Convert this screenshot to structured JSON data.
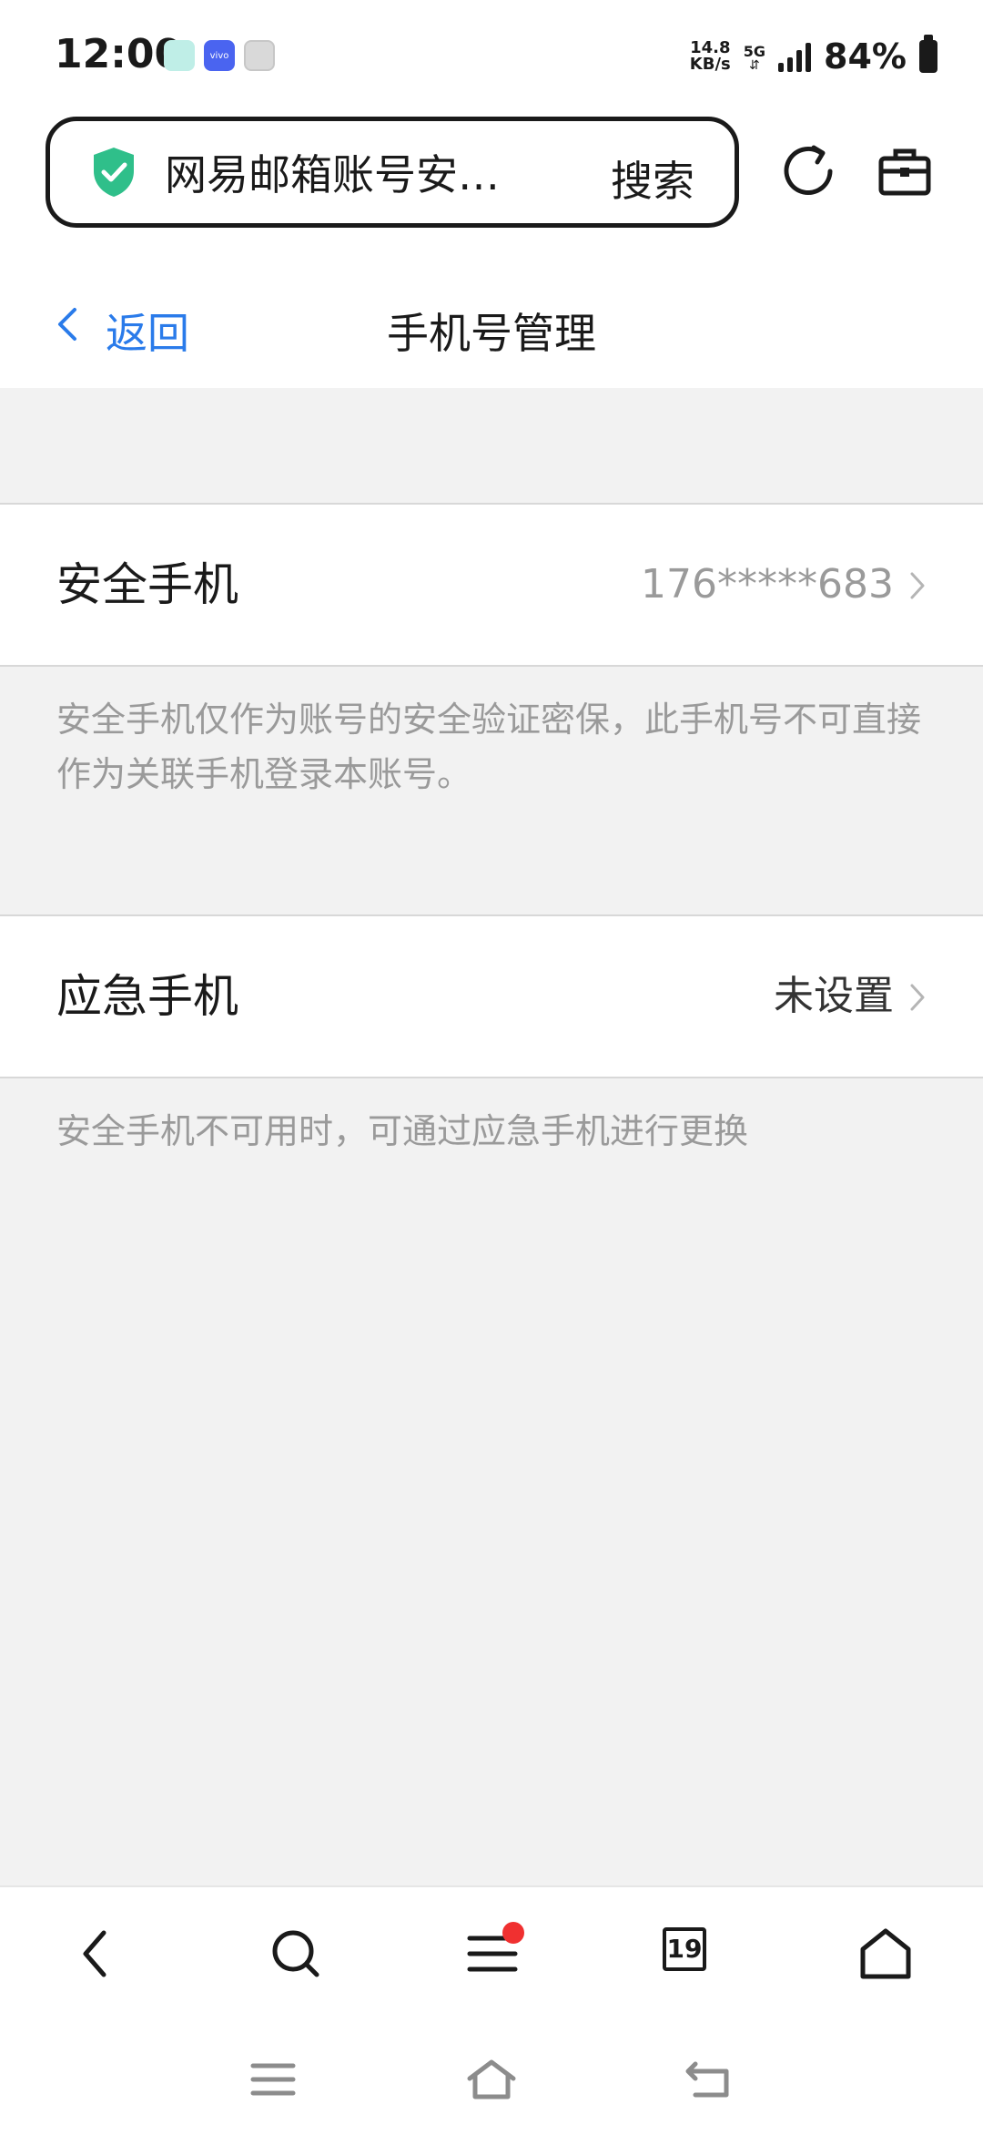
{
  "status_bar": {
    "time": "12:00",
    "net_speed_value": "14.8",
    "net_speed_unit": "KB/s",
    "network_type": "5G",
    "battery": "84%",
    "app_icons": [
      "teal-app-icon",
      "vivo-app-icon",
      "gray-app-icon"
    ],
    "vivo_label": "vivo"
  },
  "browser": {
    "url_text": "网易邮箱账号安…",
    "search_label": "搜索",
    "shield_color": "#2fbf8a"
  },
  "header": {
    "back_label": "返回",
    "title": "手机号管理"
  },
  "sections": {
    "security_phone": {
      "label": "安全手机",
      "value": "176*****683",
      "hint": "安全手机仅作为账号的安全验证密保，此手机号不可直接作为关联手机登录本账号。"
    },
    "emergency_phone": {
      "label": "应急手机",
      "value": "未设置",
      "hint": "安全手机不可用时，可通过应急手机进行更换"
    }
  },
  "bottom_nav": {
    "tab_count": "19",
    "items": [
      "back-icon",
      "search-icon",
      "menu-icon",
      "tabs-icon",
      "home-icon"
    ],
    "badge_color": "#f03030"
  },
  "system_nav": {
    "items": [
      "recent-apps-icon",
      "system-home-icon",
      "system-back-icon"
    ]
  },
  "colors": {
    "accent": "#2a7bea",
    "hint_text": "#9a9a9a",
    "value_text": "#9a9a9a",
    "background": "#f2f2f2"
  }
}
